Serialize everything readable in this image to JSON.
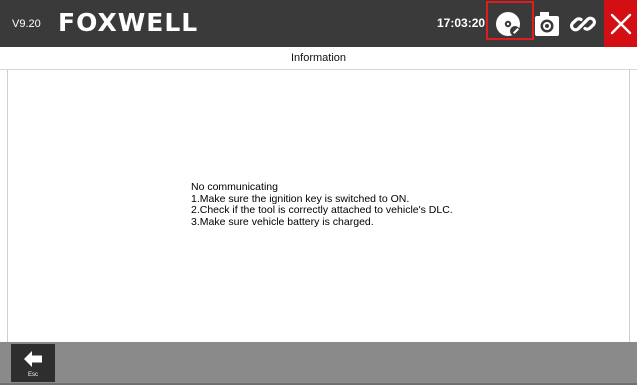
{
  "header": {
    "version": "V9.20",
    "brand": "FOXWELL",
    "time": "17:03:20",
    "icons": {
      "diagnostic": "vci-disc-icon",
      "screenshot": "camera-icon",
      "connection": "link-icon",
      "close": "close-icon"
    },
    "close_bg": "#d40f14"
  },
  "page": {
    "title": "Information"
  },
  "message": {
    "lines": [
      "No communicating",
      "1.Make sure the ignition key is switched to ON.",
      "2.Check if the tool is correctly attached to vehicle's DLC.",
      "3.Make sure vehicle battery is charged."
    ]
  },
  "footer": {
    "esc_label": "Esc"
  }
}
